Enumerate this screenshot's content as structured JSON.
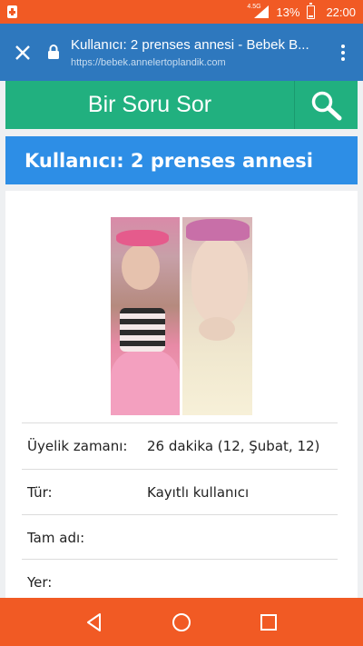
{
  "status_bar": {
    "network_type": "4.5G",
    "battery_percent": "13%",
    "time": "22:00",
    "icons": [
      "app-notification-icon",
      "signal-icon",
      "battery-icon"
    ]
  },
  "browser": {
    "page_title": "Kullanıcı: 2 prenses annesi - Bebek B...",
    "url": "https://bebek.annelertoplandik.com",
    "icons": [
      "close-icon",
      "lock-icon",
      "overflow-menu-icon"
    ]
  },
  "ask_bar": {
    "label": "Bir Soru Sor",
    "icon": "search-icon"
  },
  "header": {
    "title": "Kullanıcı: 2 prenses annesi"
  },
  "profile": {
    "rows": [
      {
        "label": "Üyelik zamanı:",
        "value": "26 dakika (12, Şubat, 12)"
      },
      {
        "label": "Tür:",
        "value": "Kayıtlı kullanıcı"
      },
      {
        "label": "Tam adı:",
        "value": ""
      },
      {
        "label": "Yer:",
        "value": ""
      }
    ]
  },
  "nav_bar": {
    "icons": [
      "back-icon",
      "home-icon",
      "recents-icon"
    ]
  },
  "colors": {
    "status_bar": "#f15a24",
    "browser_bar": "#2e78be",
    "ask_bar": "#21b07f",
    "header": "#2d8ee6"
  }
}
